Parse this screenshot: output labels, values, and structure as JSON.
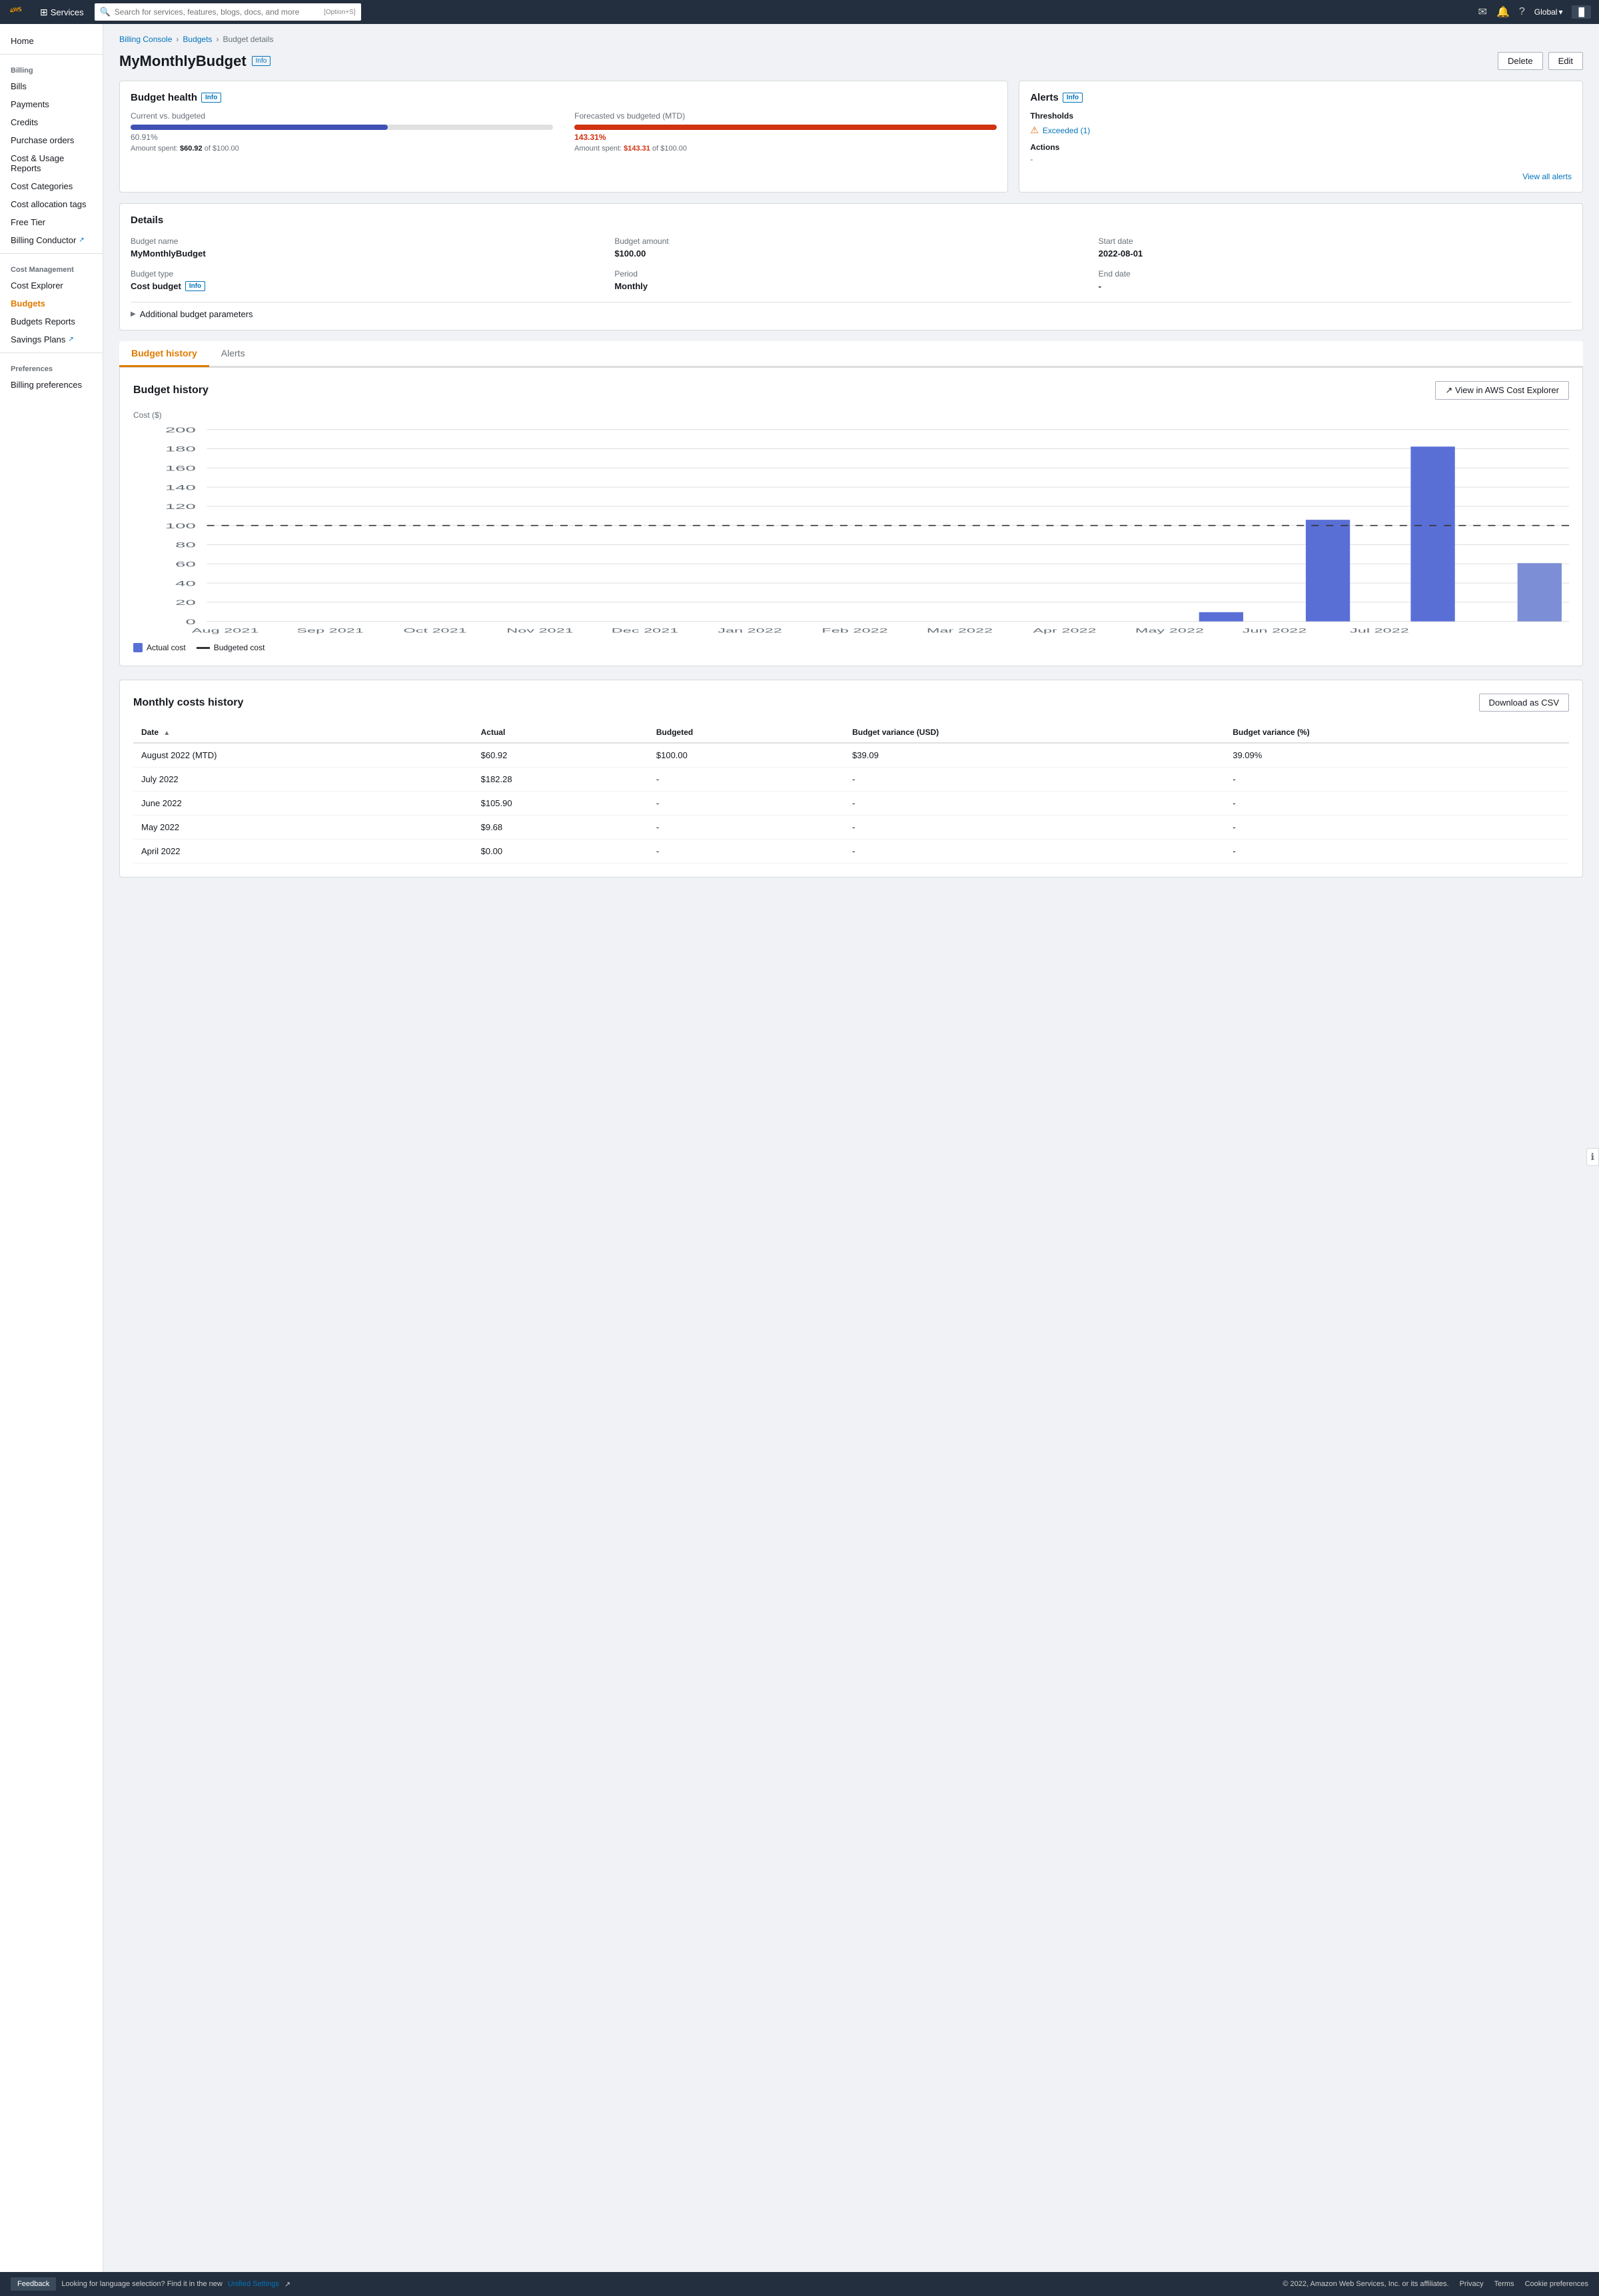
{
  "topnav": {
    "search_placeholder": "Search for services, features, blogs, docs, and more",
    "search_shortcut": "[Option+S]",
    "services_label": "Services",
    "global_label": "Global",
    "account_label": "▐"
  },
  "sidebar": {
    "home": "Home",
    "billing_section": "Billing",
    "bills": "Bills",
    "payments": "Payments",
    "credits": "Credits",
    "purchase_orders": "Purchase orders",
    "cost_usage_reports": "Cost & Usage Reports",
    "cost_categories": "Cost Categories",
    "cost_allocation_tags": "Cost allocation tags",
    "free_tier": "Free Tier",
    "billing_conductor": "Billing Conductor",
    "cost_management_section": "Cost Management",
    "cost_explorer": "Cost Explorer",
    "budgets": "Budgets",
    "budgets_reports": "Budgets Reports",
    "savings_plans": "Savings Plans",
    "preferences_section": "Preferences",
    "billing_preferences": "Billing preferences"
  },
  "breadcrumb": {
    "billing_console": "Billing Console",
    "budgets": "Budgets",
    "budget_details": "Budget details"
  },
  "page": {
    "title": "MyMonthlyBudget",
    "info_label": "Info",
    "delete_btn": "Delete",
    "edit_btn": "Edit"
  },
  "budget_health": {
    "title": "Budget health",
    "info_label": "Info",
    "current_vs_budgeted_label": "Current vs. budgeted",
    "current_pct": "60.91%",
    "current_amount": "Amount spent: $60.92 of $100.00",
    "current_amount_spent": "$60.92",
    "current_amount_total": "$100.00",
    "current_fill": 60.91,
    "forecasted_label": "Forecasted vs budgeted (MTD)",
    "forecasted_pct": "143.31%",
    "forecasted_amount": "Amount spent: $143.31 of $100.00",
    "forecasted_amount_spent": "$143.31",
    "forecasted_amount_total": "$100.00",
    "forecasted_fill": 100
  },
  "alerts": {
    "title": "Alerts",
    "info_label": "Info",
    "thresholds_label": "Thresholds",
    "exceeded_label": "Exceeded (1)",
    "actions_label": "Actions",
    "actions_dash": "-",
    "view_all_label": "View all alerts"
  },
  "details": {
    "title": "Details",
    "budget_name_label": "Budget name",
    "budget_name_value": "MyMonthlyBudget",
    "budget_amount_label": "Budget amount",
    "budget_amount_value": "$100.00",
    "start_date_label": "Start date",
    "start_date_value": "2022-08-01",
    "budget_type_label": "Budget type",
    "budget_type_value": "Cost budget",
    "info_label": "Info",
    "period_label": "Period",
    "period_value": "Monthly",
    "end_date_label": "End date",
    "end_date_dash": "-",
    "additional_params": "Additional budget parameters"
  },
  "tabs": {
    "budget_history": "Budget history",
    "alerts": "Alerts"
  },
  "budget_history": {
    "title": "Budget history",
    "view_in_explorer_btn": "View in AWS Cost Explorer",
    "y_axis_label": "Cost ($)",
    "y_values": [
      "200",
      "180",
      "160",
      "140",
      "120",
      "100",
      "80",
      "60",
      "40",
      "20",
      "0"
    ],
    "x_labels": [
      "Aug 2021",
      "Sep 2021",
      "Oct 2021",
      "Nov 2021",
      "Dec 2021",
      "Jan 2022",
      "Feb 2022",
      "Mar 2022",
      "Apr 2022",
      "May 2022",
      "Jun 2022",
      "Jul 2022"
    ],
    "bars": [
      {
        "month": "Aug 2021",
        "value": 0
      },
      {
        "month": "Sep 2021",
        "value": 0
      },
      {
        "month": "Oct 2021",
        "value": 0
      },
      {
        "month": "Nov 2021",
        "value": 0
      },
      {
        "month": "Dec 2021",
        "value": 0
      },
      {
        "month": "Jan 2022",
        "value": 0
      },
      {
        "month": "Feb 2022",
        "value": 0
      },
      {
        "month": "Mar 2022",
        "value": 0
      },
      {
        "month": "Apr 2022",
        "value": 0
      },
      {
        "month": "May 2022",
        "value": 10
      },
      {
        "month": "Jun 2022",
        "value": 106
      },
      {
        "month": "Jul 2022",
        "value": 182
      }
    ],
    "partial_bar": {
      "month": "Aug 2022",
      "value": 61
    },
    "legend_actual": "Actual cost",
    "legend_budgeted": "Budgeted cost"
  },
  "monthly_costs": {
    "title": "Monthly costs history",
    "download_csv_btn": "Download as CSV",
    "columns": [
      "Date",
      "Actual",
      "Budgeted",
      "Budget variance (USD)",
      "Budget variance (%)"
    ],
    "rows": [
      {
        "date": "August 2022 (MTD)",
        "actual": "$60.92",
        "budgeted": "$100.00",
        "variance_usd": "$39.09",
        "variance_pct": "39.09%"
      },
      {
        "date": "July 2022",
        "actual": "$182.28",
        "budgeted": "-",
        "variance_usd": "-",
        "variance_pct": "-"
      },
      {
        "date": "June 2022",
        "actual": "$105.90",
        "budgeted": "-",
        "variance_usd": "-",
        "variance_pct": "-"
      },
      {
        "date": "May 2022",
        "actual": "$9.68",
        "budgeted": "-",
        "variance_usd": "-",
        "variance_pct": "-"
      },
      {
        "date": "April 2022",
        "actual": "$0.00",
        "budgeted": "-",
        "variance_usd": "-",
        "variance_pct": "-"
      }
    ]
  },
  "footer": {
    "feedback_btn": "Feedback",
    "language_msg": "Looking for language selection? Find it in the new",
    "unified_settings": "Unified Settings",
    "copyright": "© 2022, Amazon Web Services, Inc. or its affiliates.",
    "privacy": "Privacy",
    "terms": "Terms",
    "cookie_prefs": "Cookie preferences"
  }
}
